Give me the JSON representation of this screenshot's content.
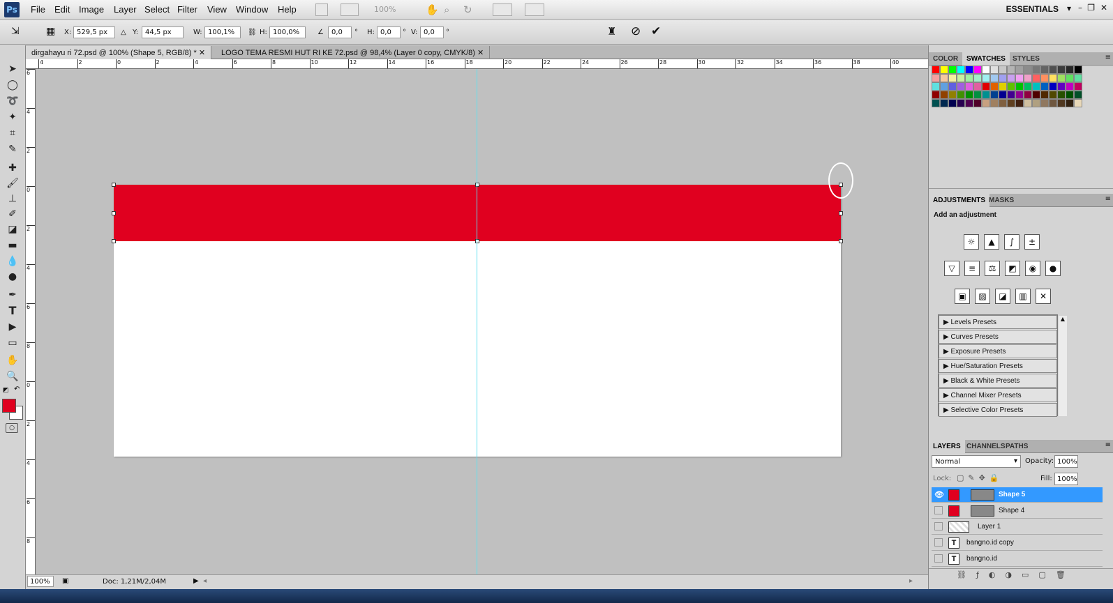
{
  "app": {
    "logo": "Ps",
    "workspace": "ESSENTIALS"
  },
  "menu": [
    "File",
    "Edit",
    "Image",
    "Layer",
    "Select",
    "Filter",
    "View",
    "Window",
    "Help"
  ],
  "toolbar_top": {
    "zoom": "100%"
  },
  "options": {
    "x_label": "X:",
    "x": "529,5 px",
    "y_label": "Y:",
    "y": "44,5 px",
    "w_label": "W:",
    "w": "100,1%",
    "h_label": "H:",
    "h": "100,0%",
    "angle": "0,0",
    "hskew_label": "H:",
    "hskew": "0,0",
    "vskew_label": "V:",
    "vskew": "0,0",
    "deg": "°"
  },
  "tabs": [
    {
      "label": "dirgahayu ri 72.psd @ 100% (Shape 5, RGB/8) *"
    },
    {
      "label": "LOGO TEMA RESMI HUT RI KE 72.psd @ 98,4% (Layer 0 copy, CMYK/8)"
    }
  ],
  "ruler": {
    "h": [
      "4",
      "2",
      "0",
      "2",
      "4",
      "6",
      "8",
      "10",
      "12",
      "14",
      "16",
      "18",
      "20",
      "22",
      "24",
      "26",
      "28",
      "30",
      "32",
      "34",
      "36",
      "38",
      "40"
    ],
    "v": [
      "6",
      "4",
      "2",
      "0",
      "2",
      "4",
      "6",
      "8",
      "0",
      "2",
      "4",
      "6",
      "8"
    ]
  },
  "status": {
    "zoom": "100%",
    "doc": "Doc: 1,21M/2,04M"
  },
  "panels": {
    "color_tabs": [
      "COLOR",
      "SWATCHES",
      "STYLES"
    ],
    "swatches": [
      "#ff0000",
      "#ffff00",
      "#00ff00",
      "#00ffff",
      "#0000ff",
      "#ff00ff",
      "#ffffff",
      "#e0e0e0",
      "#c8c8c8",
      "#b4b4b4",
      "#a0a0a0",
      "#8c8c8c",
      "#787878",
      "#646464",
      "#505050",
      "#3c3c3c",
      "#282828",
      "#000000",
      "#f5a0a0",
      "#f5c8a0",
      "#f5f0a0",
      "#c8f0a0",
      "#a0f0a0",
      "#a0f0c8",
      "#a0f0f0",
      "#a0c8f0",
      "#a0a0f0",
      "#c8a0f0",
      "#f0a0f0",
      "#f0a0c8",
      "#ff6060",
      "#ff9060",
      "#ffe060",
      "#a0e060",
      "#60e060",
      "#60e0a0",
      "#60e0e0",
      "#60a0e0",
      "#6060e0",
      "#a060e0",
      "#e060e0",
      "#e060a0",
      "#e00000",
      "#e06000",
      "#e0d000",
      "#60c000",
      "#00c000",
      "#00c060",
      "#00c0c0",
      "#0060c0",
      "#0000c0",
      "#6000c0",
      "#c000c0",
      "#c00060",
      "#900000",
      "#904000",
      "#908000",
      "#409000",
      "#009000",
      "#009040",
      "#009090",
      "#004090",
      "#000090",
      "#400090",
      "#900090",
      "#900040",
      "#500000",
      "#502800",
      "#504800",
      "#285000",
      "#005000",
      "#005028",
      "#005050",
      "#002850",
      "#000050",
      "#280050",
      "#500050",
      "#500028",
      "#c8a080",
      "#a08060",
      "#806040",
      "#604020",
      "#402010",
      "#d0c0a0",
      "#b0a080",
      "#907860",
      "#705840",
      "#503820",
      "#302010",
      "#e8d8b8"
    ],
    "adj_tabs": [
      "ADJUSTMENTS",
      "MASKS"
    ],
    "adj_title": "Add an adjustment",
    "presets": [
      "Levels Presets",
      "Curves Presets",
      "Exposure Presets",
      "Hue/Saturation Presets",
      "Black & White Presets",
      "Channel Mixer Presets",
      "Selective Color Presets"
    ],
    "layer_tabs": [
      "LAYERS",
      "CHANNELS",
      "PATHS"
    ],
    "blend": "Normal",
    "opacity_label": "Opacity:",
    "opacity": "100%",
    "lock_label": "Lock:",
    "fill_label": "Fill:",
    "fill": "100%",
    "layers": [
      {
        "name": "Shape 5"
      },
      {
        "name": "Shape 4"
      },
      {
        "name": "Layer 1"
      },
      {
        "name": "bangno.id copy"
      },
      {
        "name": "bangno.id"
      }
    ]
  },
  "colors": {
    "foreground": "#e0001f",
    "accent": "#3399ff",
    "red_band": "#e0001f"
  }
}
